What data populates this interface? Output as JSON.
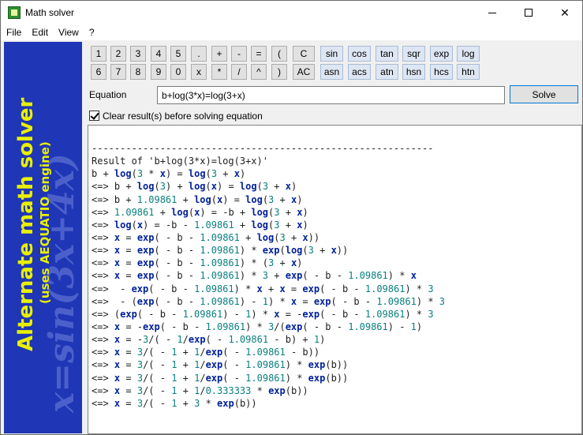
{
  "window": {
    "title": "Math solver"
  },
  "menu": [
    "File",
    "Edit",
    "View",
    "?"
  ],
  "banner": {
    "line1": "Alternate math solver",
    "line2": "(uses AEQUATIO engine)",
    "formula": "x=sin(3x+4x)"
  },
  "keypad": {
    "row1": [
      "1",
      "2",
      "3",
      "4",
      "5",
      ".",
      "+",
      "-",
      "=",
      "(",
      "C",
      "sin",
      "cos",
      "tan",
      "sqr",
      "exp",
      "log"
    ],
    "row2": [
      "6",
      "7",
      "8",
      "9",
      "0",
      "x",
      "*",
      "/",
      "^",
      ")",
      "AC",
      "asn",
      "acs",
      "atn",
      "hsn",
      "hcs",
      "htn"
    ]
  },
  "equation": {
    "label": "Equation",
    "value": "b+log(3*x)=log(3+x)",
    "solve_label": "Solve"
  },
  "options": {
    "clear_label": "Clear result(s) before solving equation",
    "clear_checked": true
  },
  "results": [
    "------------------------------------------------------------",
    "Result of 'b+log(3*x)=log(3+x)'",
    "b + log(3 * x) = log(3 + x)",
    "<=> b + log(3) + log(x) = log(3 + x)",
    "<=> b + 1.09861 + log(x) = log(3 + x)",
    "<=> 1.09861 + log(x) = -b + log(3 + x)",
    "<=> log(x) = -b - 1.09861 + log(3 + x)",
    "<=> x = exp( - b - 1.09861 + log(3 + x))",
    "<=> x = exp( - b - 1.09861) * exp(log(3 + x))",
    "<=> x = exp( - b - 1.09861) * (3 + x)",
    "<=> x = exp( - b - 1.09861) * 3 + exp( - b - 1.09861) * x",
    "<=>  - exp( - b - 1.09861) * x + x = exp( - b - 1.09861) * 3",
    "<=>  - (exp( - b - 1.09861) - 1) * x = exp( - b - 1.09861) * 3",
    "<=> (exp( - b - 1.09861) - 1) * x = -exp( - b - 1.09861) * 3",
    "<=> x = -exp( - b - 1.09861) * 3/(exp( - b - 1.09861) - 1)",
    "<=> x = -3/( - 1/exp( - 1.09861 - b) + 1)",
    "<=> x = 3/( - 1 + 1/exp( - 1.09861 - b))",
    "<=> x = 3/( - 1 + 1/exp( - 1.09861) * exp(b))",
    "<=> x = 3/( - 1 + 1/exp( - 1.09861) * exp(b))",
    "<=> x = 3/( - 1 + 1/0.333333 * exp(b))",
    "<=> x = 3/( - 1 + 3 * exp(b))"
  ]
}
